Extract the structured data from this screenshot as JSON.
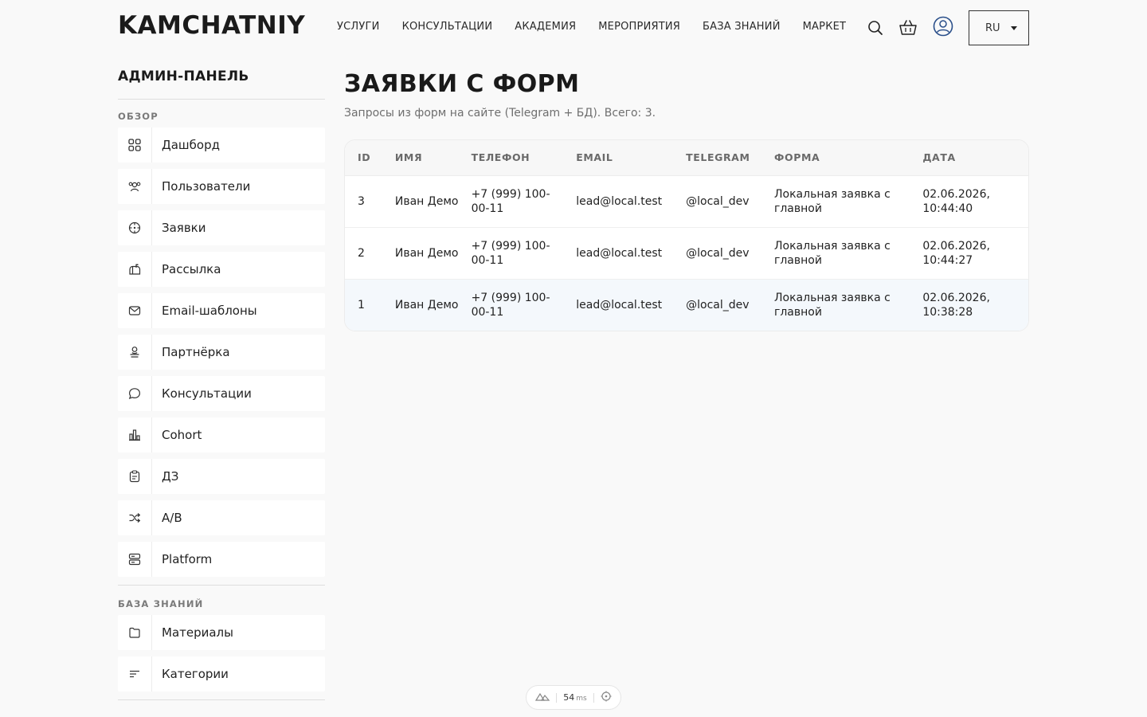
{
  "header": {
    "logo": "KAMCHATNIY",
    "nav": [
      "УСЛУГИ",
      "КОНСУЛЬТАЦИИ",
      "АКАДЕМИЯ",
      "МЕРОПРИЯТИЯ",
      "БАЗА ЗНАНИЙ",
      "МАРКЕТ"
    ],
    "icons": [
      "search-icon",
      "cart-icon",
      "user-icon"
    ],
    "lang": "RU"
  },
  "sidebar": {
    "title": "АДМИН-ПАНЕЛЬ",
    "section1": "ОБЗОР",
    "items": [
      {
        "label": "Дашборд",
        "icon": "grid-icon"
      },
      {
        "label": "Пользователи",
        "icon": "users-icon"
      },
      {
        "label": "Заявки",
        "icon": "target-icon"
      },
      {
        "label": "Рассылка",
        "icon": "mailbox-icon"
      },
      {
        "label": "Email-шаблоны",
        "icon": "envelope-icon"
      },
      {
        "label": "Партнёрка",
        "icon": "partner-icon"
      },
      {
        "label": "Консультации",
        "icon": "chat-icon"
      },
      {
        "label": "Cohort",
        "icon": "bar-chart-icon"
      },
      {
        "label": "ДЗ",
        "icon": "clipboard-icon"
      },
      {
        "label": "A/B",
        "icon": "shuffle-icon"
      },
      {
        "label": "Platform",
        "icon": "server-icon"
      }
    ],
    "section2": "БАЗА ЗНАНИЙ",
    "items2": [
      {
        "label": "Материалы",
        "icon": "folder-icon"
      },
      {
        "label": "Категории",
        "icon": "list-icon"
      }
    ]
  },
  "main": {
    "title": "ЗАЯВКИ С ФОРМ",
    "subtitle": "Запросы из форм на сайте (Telegram + БД). Всего: 3.",
    "columns": [
      "ID",
      "ИМЯ",
      "ТЕЛЕФОН",
      "EMAIL",
      "TELEGRAM",
      "ФОРМА",
      "ДАТА"
    ],
    "rows": [
      {
        "id": "3",
        "name": "Иван Демо",
        "phone": "+7 (999) 100-00-11",
        "email": "lead@local.test",
        "telegram": "@local_dev",
        "form": "Локальная заявка с главной",
        "date": "02.06.2026, 10:44:40"
      },
      {
        "id": "2",
        "name": "Иван Демо",
        "phone": "+7 (999) 100-00-11",
        "email": "lead@local.test",
        "telegram": "@local_dev",
        "form": "Локальная заявка с главной",
        "date": "02.06.2026, 10:44:27"
      },
      {
        "id": "1",
        "name": "Иван Демо",
        "phone": "+7 (999) 100-00-11",
        "email": "lead@local.test",
        "telegram": "@local_dev",
        "form": "Локальная заявка с главной",
        "date": "02.06.2026, 10:38:28"
      }
    ]
  },
  "devtools": {
    "value": "54",
    "unit": "ms"
  }
}
